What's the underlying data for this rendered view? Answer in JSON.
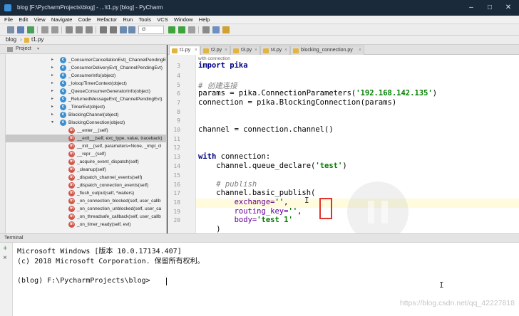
{
  "window": {
    "title": "blog [F:\\PycharmProjects\\blog] - ...\\t1.py [blog] - PyCharm"
  },
  "menu": [
    "File",
    "Edit",
    "View",
    "Navigate",
    "Code",
    "Refactor",
    "Run",
    "Tools",
    "VCS",
    "Window",
    "Help"
  ],
  "toolbar": {
    "run_config": "t3"
  },
  "navbar": {
    "crumbs": [
      "blog",
      "t1.py"
    ]
  },
  "project_panel": {
    "label": "Project",
    "items": [
      {
        "badge": "c",
        "label": "_ConsumerCancellationEvt(_ChannelPendingEvt)",
        "expandable": true
      },
      {
        "badge": "c",
        "label": "_ConsumerDeliveryEvt(_ChannelPendingEvt)",
        "expandable": true
      },
      {
        "badge": "c",
        "label": "_ConsumerInfo(object)",
        "expandable": true
      },
      {
        "badge": "c",
        "label": "_IoloopTimerContext(object)",
        "expandable": true
      },
      {
        "badge": "c",
        "label": "_QueueConsumerGeneratorInfo(object)",
        "expandable": true
      },
      {
        "badge": "c",
        "label": "_ReturnedMessageEvt(_ChannelPendingEvt)",
        "expandable": true
      },
      {
        "badge": "c",
        "label": "_TimerEvt(object)",
        "expandable": true
      },
      {
        "badge": "c",
        "label": "BlockingChannel(object)",
        "expandable": true
      },
      {
        "badge": "c",
        "label": "BlockingConnection(object)",
        "expandable": true,
        "expanded": true
      },
      {
        "badge": "m",
        "label": "__enter__(self)",
        "child": true
      },
      {
        "badge": "m",
        "label": "__exit__(self, exc_type, value, traceback)",
        "child": true,
        "selected": true
      },
      {
        "badge": "m",
        "label": "__init__(self, parameters=None, _impl_cl",
        "child": true
      },
      {
        "badge": "m",
        "label": "__repr__(self)",
        "child": true
      },
      {
        "badge": "m",
        "label": "_acquire_event_dispatch(self)",
        "child": true
      },
      {
        "badge": "m",
        "label": "_cleanup(self)",
        "child": true
      },
      {
        "badge": "m",
        "label": "_dispatch_channel_events(self)",
        "child": true
      },
      {
        "badge": "m",
        "label": "_dispatch_connection_events(self)",
        "child": true
      },
      {
        "badge": "m",
        "label": "_flush_output(self, *waiters)",
        "child": true
      },
      {
        "badge": "m",
        "label": "_on_connection_blocked(self, user_callb",
        "child": true
      },
      {
        "badge": "m",
        "label": "_on_connection_unblocked(self, user_ca",
        "child": true
      },
      {
        "badge": "m",
        "label": "_on_threadsafe_callback(self, user_callb",
        "child": true
      },
      {
        "badge": "m",
        "label": "_on_timer_ready(self, evt)",
        "child": true
      }
    ]
  },
  "tabs": [
    {
      "label": "t1.py",
      "active": true
    },
    {
      "label": "t2.py"
    },
    {
      "label": "t3.py"
    },
    {
      "label": "t4.py"
    },
    {
      "label": "blocking_connection.py"
    }
  ],
  "editor": {
    "hint": "with connection",
    "line_numbers": [
      "3",
      "4",
      "5",
      "6",
      "7",
      "8",
      "9",
      "10",
      "11",
      "12",
      "13",
      "14",
      "15",
      "16",
      "17",
      "18",
      "19",
      "20"
    ],
    "lines": {
      "l1": "import pika",
      "l2_comment": "# 创建连接",
      "l3_a": "params = pika.ConnectionParameters(",
      "l3_str": "'192.168.142.135'",
      "l3_b": ")",
      "l4": "connection = pika.BlockingConnection(params)",
      "l5": "channel = connection.channel()",
      "l6_kw": "with",
      "l6_rest": " connection:",
      "l7_a": "    channel.queue_declare(",
      "l7_str": "'test'",
      "l7_b": ")",
      "l8_comment": "    # publish",
      "l9": "    channel.basic_publish(",
      "l10_param": "        exchange=",
      "l10_str": "''",
      "l10_b": ",",
      "l11_param": "        routing_key=",
      "l11_str": "''",
      "l11_b": ",",
      "l12_param": "        body=",
      "l12_str": "'test 1'",
      "l13": "    )"
    }
  },
  "terminal": {
    "label": "Terminal",
    "lines": [
      "Microsoft Windows [版本 10.0.17134.407]",
      "(c) 2018 Microsoft Corporation. 保留所有权利。",
      "",
      "(blog) F:\\PycharmProjects\\blog>"
    ],
    "watermark": "https://blog.csdn.net/qq_42227818"
  },
  "colors": {
    "annotation_box": "#e2322f",
    "string": "#008000",
    "keyword": "#000080"
  }
}
